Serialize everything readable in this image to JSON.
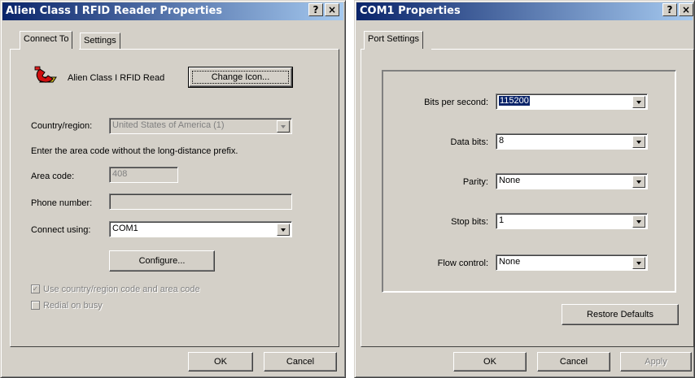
{
  "win1": {
    "title": "Alien Class I RFID Reader Properties",
    "help_label": "?",
    "close_label": "×",
    "tabs": [
      "Connect To",
      "Settings"
    ],
    "connection_name": "Alien Class I RFID Read",
    "change_icon_label": "Change Icon...",
    "country_label": "Country/region:",
    "country_value": "United States of America (1)",
    "instruction": "Enter the area code without the long-distance prefix.",
    "area_code_label": "Area code:",
    "area_code_value": "408",
    "phone_label": "Phone number:",
    "phone_value": "",
    "connect_using_label": "Connect using:",
    "connect_using_value": "COM1",
    "configure_label": "Configure...",
    "use_country_label": "Use country/region code and area code",
    "redial_label": "Redial on busy",
    "ok_label": "OK",
    "cancel_label": "Cancel"
  },
  "win2": {
    "title": "COM1 Properties",
    "help_label": "?",
    "close_label": "×",
    "tabs": [
      "Port Settings"
    ],
    "bits_label": "Bits per second:",
    "bits_value": "115200",
    "data_bits_label": "Data bits:",
    "data_bits_value": "8",
    "parity_label": "Parity:",
    "parity_value": "None",
    "stop_bits_label": "Stop bits:",
    "stop_bits_value": "1",
    "flow_label": "Flow control:",
    "flow_value": "None",
    "restore_label": "Restore Defaults",
    "ok_label": "OK",
    "cancel_label": "Cancel",
    "apply_label": "Apply"
  }
}
